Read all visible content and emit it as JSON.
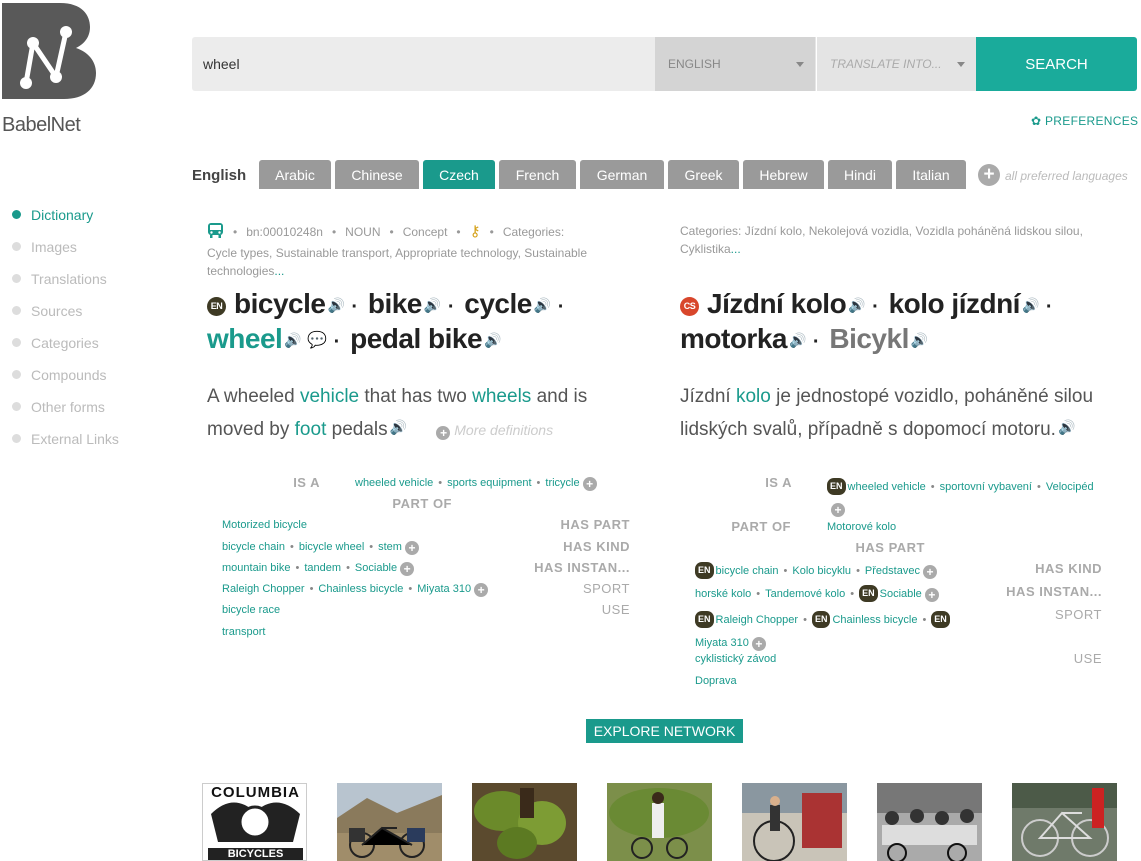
{
  "header": {
    "logo_text": "BabelNet",
    "search_value": "wheel",
    "source_language": "ENGLISH",
    "target_language_placeholder": "TRANSLATE INTO...",
    "search_button": "SEARCH",
    "preferences": "PREFERENCES"
  },
  "languages": {
    "current": "English",
    "tabs": [
      "Arabic",
      "Chinese",
      "Czech",
      "French",
      "German",
      "Greek",
      "Hebrew",
      "Hindi",
      "Italian"
    ],
    "active": "Czech",
    "all_preferred": "all preferred languages"
  },
  "sidebar": {
    "items": [
      {
        "label": "Dictionary",
        "active": true
      },
      {
        "label": "Images",
        "active": false
      },
      {
        "label": "Translations",
        "active": false
      },
      {
        "label": "Sources",
        "active": false
      },
      {
        "label": "Categories",
        "active": false
      },
      {
        "label": "Compounds",
        "active": false
      },
      {
        "label": "Other forms",
        "active": false
      },
      {
        "label": "External Links",
        "active": false
      }
    ]
  },
  "left": {
    "meta": {
      "id": "bn:00010248n",
      "pos": "NOUN",
      "type": "Concept",
      "categories_label": "Categories:",
      "categories_line1": "Cycle types, Sustainable transport, Appropriate technology, Sustainable",
      "categories_line2": "technologies",
      "more": "..."
    },
    "lang_badge": "EN",
    "lemmas": [
      "bicycle",
      "bike",
      "cycle",
      "wheel",
      "pedal bike"
    ],
    "definition": {
      "t1": "A wheeled ",
      "l1": "vehicle",
      "t2": " that has two ",
      "l2": "wheels",
      "t3": " and is",
      "t4": "moved by ",
      "l3": "foot",
      "t5": " pedals"
    },
    "more_definitions": "More definitions",
    "relations": {
      "is_a_label": "IS A",
      "is_a": [
        "wheeled vehicle",
        "sports equipment",
        "tricycle"
      ],
      "part_of_label": "PART OF",
      "part_of": [
        "Motorized bicycle"
      ],
      "has_part_label": "HAS PART",
      "has_part": [
        "bicycle chain",
        "bicycle wheel",
        "stem"
      ],
      "has_kind_label": "HAS KIND",
      "has_kind": [
        "mountain bike",
        "tandem",
        "Sociable"
      ],
      "has_instance_label": "HAS INSTAN...",
      "has_instance": [
        "Raleigh Chopper",
        "Chainless bicycle",
        "Miyata 310"
      ],
      "sport_label": "SPORT",
      "sport": [
        "bicycle race"
      ],
      "use_label": "USE",
      "use": [
        "transport"
      ]
    }
  },
  "right": {
    "meta": {
      "categories_line1": "Categories: Jízdní kolo, Nekolejová vozidla, Vozidla poháněná lidskou silou,",
      "categories_line2": "Cyklistika",
      "more": "..."
    },
    "lang_badge": "CS",
    "lemmas": [
      "Jízdní kolo",
      "kolo jízdní",
      "motorka",
      "Bicykl"
    ],
    "definition": {
      "t1": "Jízdní ",
      "l1": "kolo",
      "t2": " je jednostopé vozidlo, poháněné silou",
      "t3": "lidských svalů, případně s dopomocí motoru."
    },
    "relations": {
      "is_a_label": "IS A",
      "en": "EN",
      "is_a": [
        "wheeled vehicle",
        "sportovní vybavení",
        "Velocipéd"
      ],
      "part_of_label": "PART OF",
      "part_of": [
        "Motorové kolo"
      ],
      "has_part_label": "HAS PART",
      "has_part": [
        "bicycle chain",
        "Kolo bicyklu",
        "Představec"
      ],
      "has_kind_label": "HAS KIND",
      "has_kind": [
        "horské kolo",
        "Tandemové kolo",
        "Sociable"
      ],
      "has_instance_label": "HAS INSTAN...",
      "has_instance": [
        "Raleigh Chopper",
        "Chainless bicycle",
        "Miyata 310"
      ],
      "sport_label": "SPORT",
      "sport": [
        "cyklistický závod"
      ],
      "use_label": "USE",
      "use": [
        "Doprava"
      ]
    }
  },
  "explore_button": "EXPLORE NETWORK",
  "images": {
    "poster_title": "COLUMBIA",
    "poster_sub": "BICYCLES"
  },
  "colors": {
    "accent": "#1a9a8c",
    "tab": "#9a9a9a",
    "search_button": "#1aab9b"
  }
}
